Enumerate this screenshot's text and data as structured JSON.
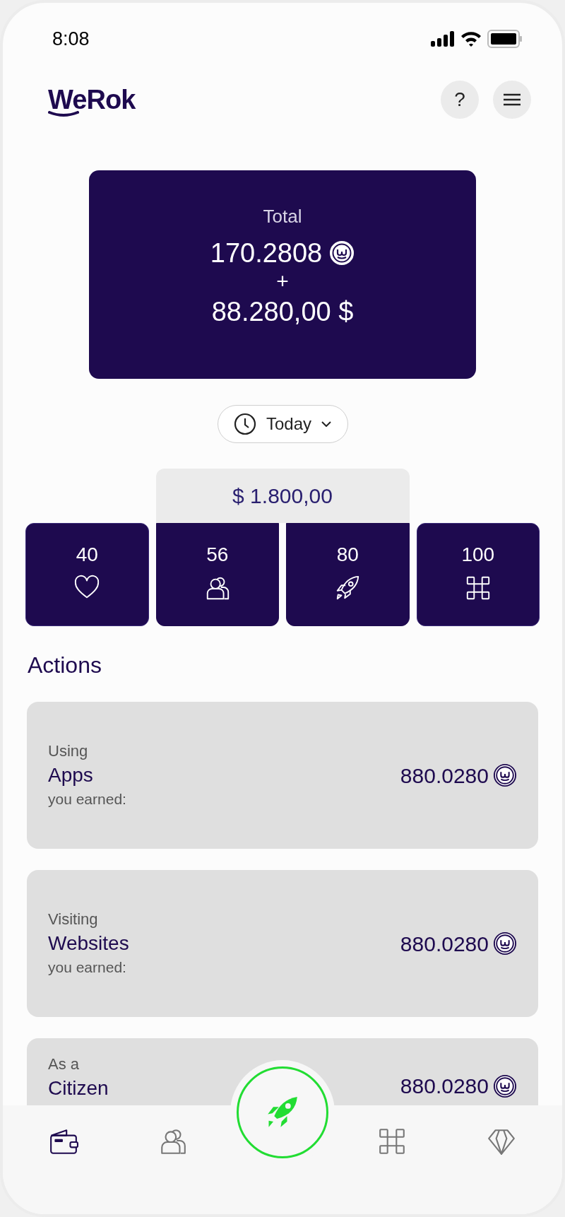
{
  "status_bar": {
    "time": "8:08"
  },
  "header": {
    "logo": "WeRok",
    "help_button": "?"
  },
  "total_card": {
    "title": "Total",
    "tokens": "170.2808",
    "plus": "+",
    "dollars": "88.280,00 $"
  },
  "period_select": {
    "value": "Today"
  },
  "stats": {
    "highlight_amount": "$ 1.800,00",
    "items": [
      {
        "value": "40",
        "kind": "heart",
        "selected": false
      },
      {
        "value": "56",
        "kind": "people",
        "selected": true
      },
      {
        "value": "80",
        "kind": "rocket",
        "selected": true
      },
      {
        "value": "100",
        "kind": "command",
        "selected": false
      }
    ]
  },
  "actions": {
    "title": "Actions",
    "items": [
      {
        "prefix": "Using",
        "name": "Apps",
        "suffix": "you earned:",
        "amount": "880.0280"
      },
      {
        "prefix": "Visiting",
        "name": "Websites",
        "suffix": "you earned:",
        "amount": "880.0280"
      },
      {
        "prefix": "As a",
        "name": "Citizen",
        "amount": "880.0280"
      }
    ]
  },
  "bottom_nav": [
    {
      "kind": "wallet",
      "selected": true
    },
    {
      "kind": "people",
      "selected": false
    },
    {
      "kind": "rocket",
      "selected": false,
      "featured": true
    },
    {
      "kind": "command",
      "selected": false
    },
    {
      "kind": "diamond",
      "selected": false
    }
  ]
}
